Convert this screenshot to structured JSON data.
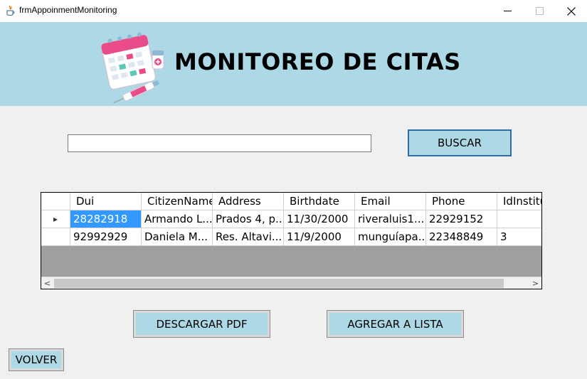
{
  "window": {
    "title": "frmAppoinmentMonitoring",
    "min_glyph": "—",
    "max_glyph": "☐",
    "close_glyph": "✕"
  },
  "banner": {
    "title": "MONITOREO DE CITAS",
    "bg_color": "#add8e6"
  },
  "search": {
    "value": "",
    "placeholder": "",
    "button_label": "BUSCAR"
  },
  "grid": {
    "columns": [
      "Dui",
      "CitizenName",
      "Address",
      "Birthdate",
      "Email",
      "Phone",
      "IdInstitu"
    ],
    "rows": [
      [
        "28282918",
        "Armando L...",
        "Prados 4, p...",
        "11/30/2000",
        "riveraluis1...",
        "22929152",
        ""
      ],
      [
        "92992929",
        "Daniela M...",
        "Res. Altavi...",
        "11/9/2000",
        "munguíapa...",
        "22348849",
        "3"
      ]
    ],
    "selected_row_indicator": "▸",
    "scroll_left": "<",
    "scroll_right": ">"
  },
  "actions": {
    "download_pdf_label": "DESCARGAR PDF",
    "add_to_list_label": "AGREGAR A LISTA",
    "back_label": "VOLVER"
  },
  "colors": {
    "button_bg": "#add8e6",
    "selection": "#3399ff",
    "grid_empty": "#a0a0a0"
  }
}
